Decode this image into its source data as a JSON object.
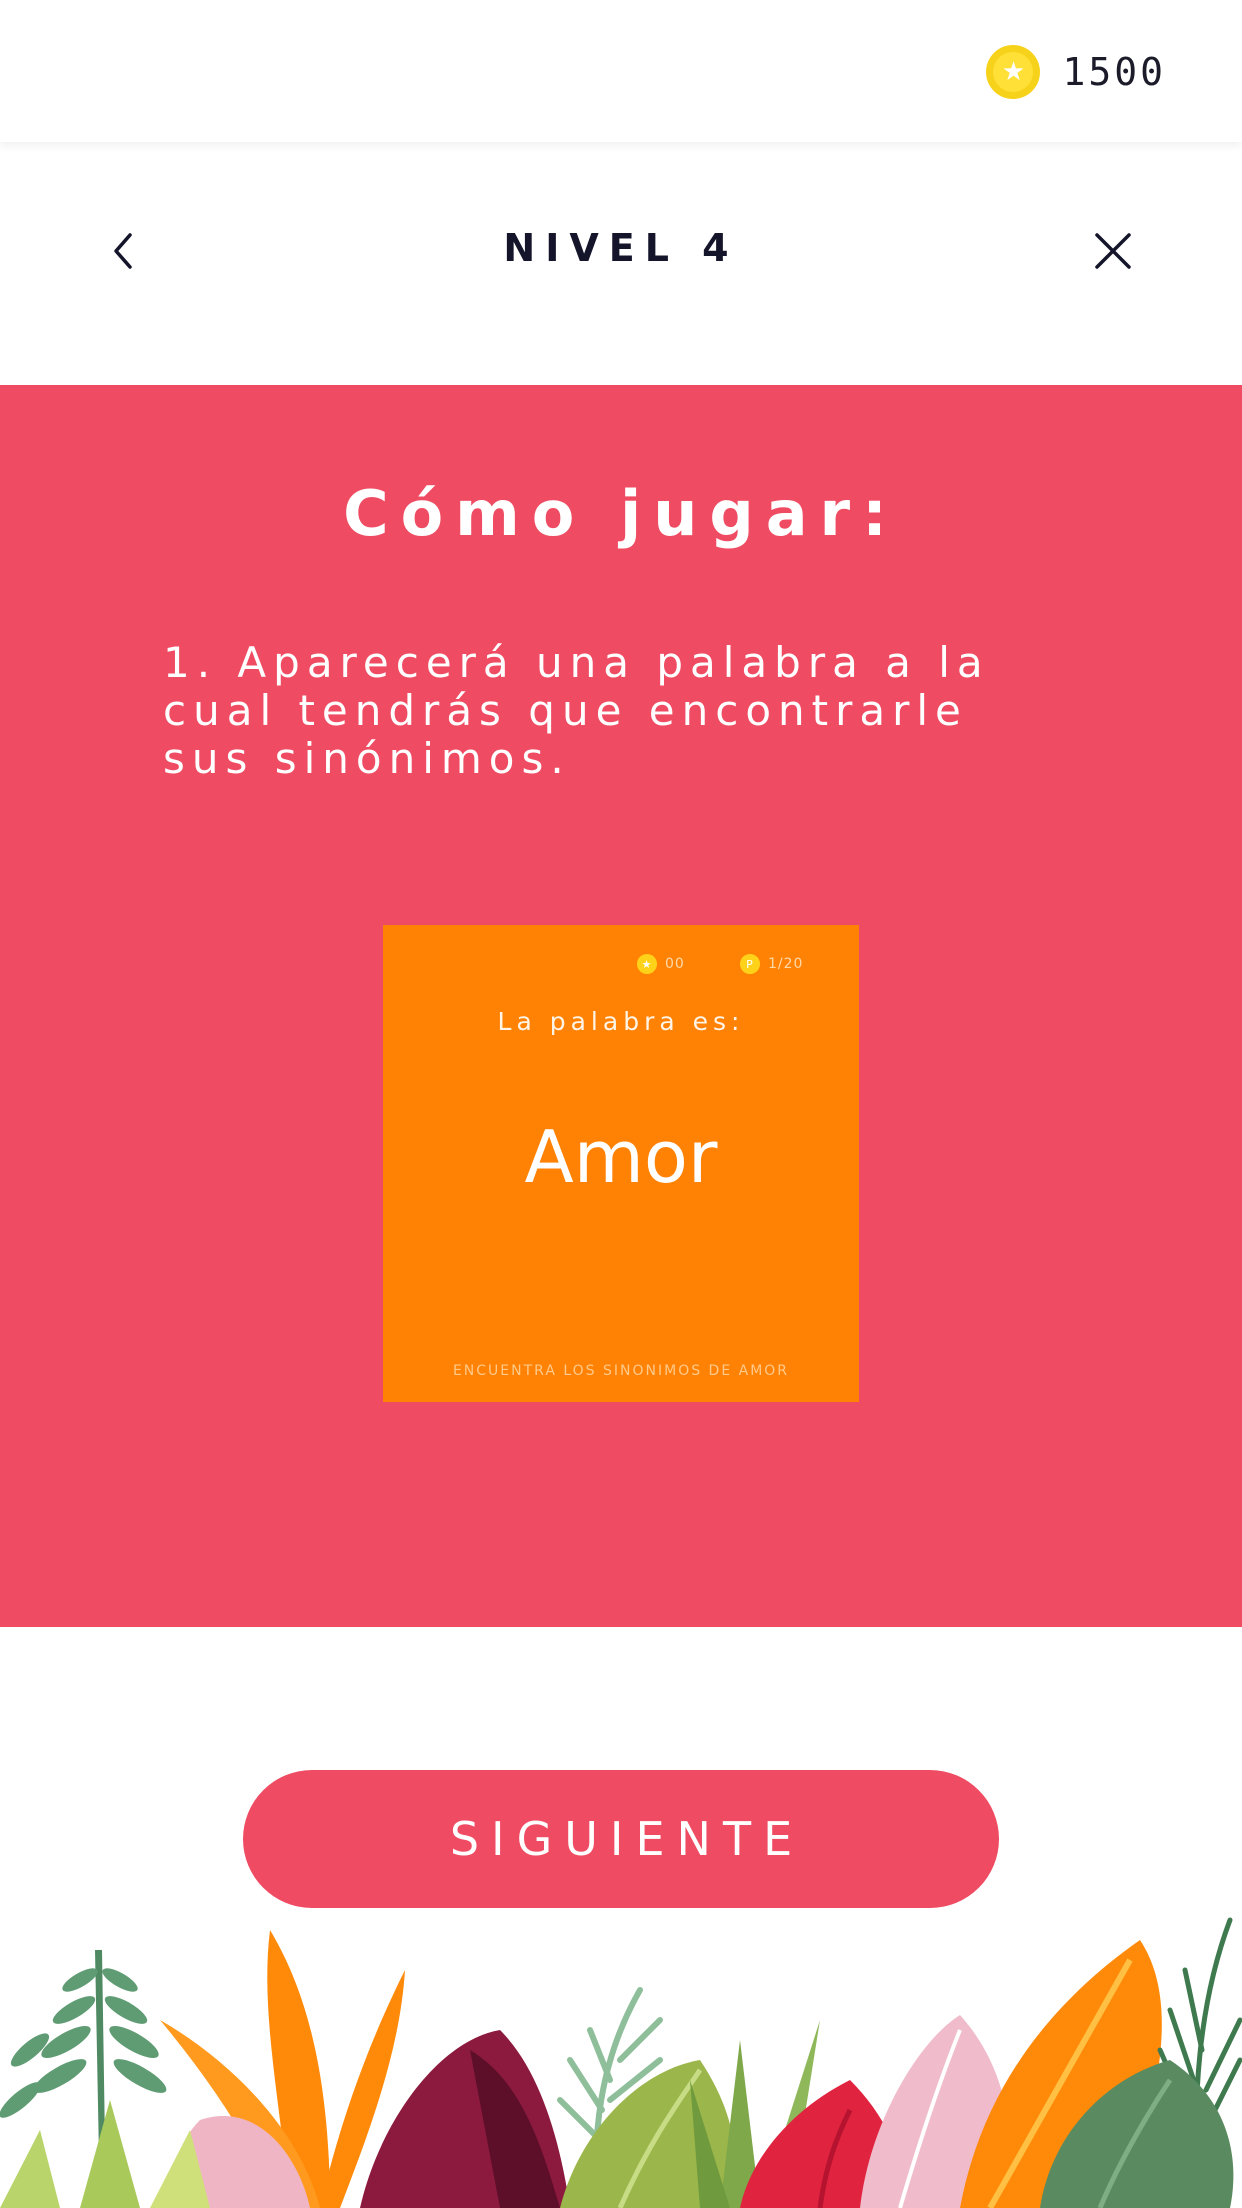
{
  "status": {
    "coins_value": "1500",
    "coin_icon": "star-coin-icon"
  },
  "header": {
    "level_title": "NIVEL 4",
    "back_icon": "chevron-left-icon",
    "close_icon": "close-icon"
  },
  "tutorial": {
    "title": "Cómo jugar:",
    "instruction": "1. Aparecerá una palabra a la\ncual tendrás que encontrarle\nsus sinónimos."
  },
  "preview_card": {
    "coins": "00",
    "progress": "1/20",
    "progress_badge": "P",
    "label": "La palabra es:",
    "word": "Amor",
    "footer": "ENCUENTRA LOS SINONIMOS DE AMOR"
  },
  "actions": {
    "next_label": "SIGUIENTE"
  },
  "colors": {
    "accent": "#ef4b62",
    "card": "#ff8204",
    "coin": "#f7d21a"
  }
}
